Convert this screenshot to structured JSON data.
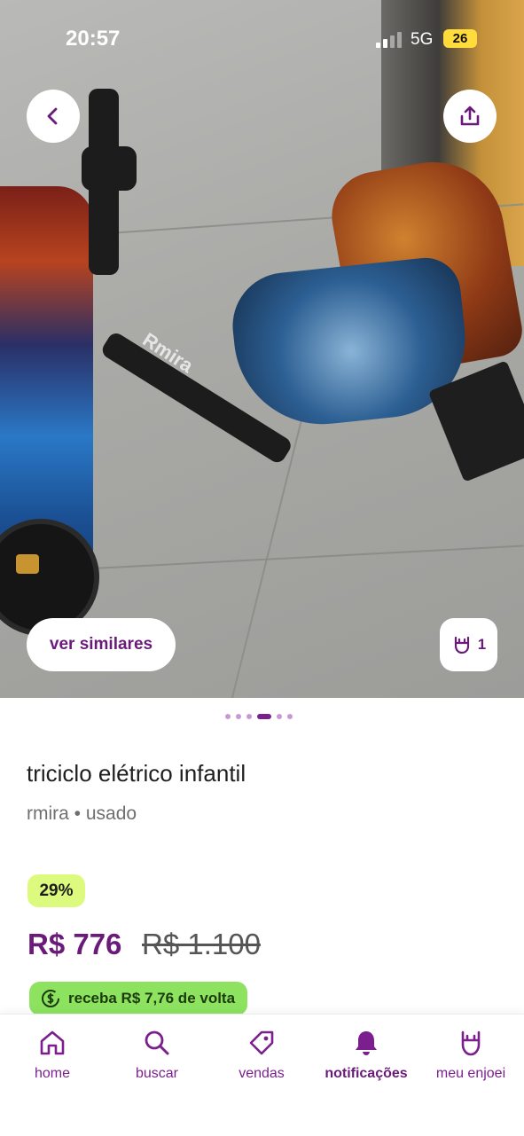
{
  "status_bar": {
    "time": "20:57",
    "network": "5G",
    "battery": "26"
  },
  "product": {
    "title": "triciclo elétrico infantil",
    "brand": "rmira",
    "condition": "usado",
    "discount": "29%",
    "price": "R$ 776",
    "old_price": "R$ 1.100",
    "cashback": "receba R$ 7,76 de volta",
    "likes": "1",
    "image_printed_brand": "Rmira"
  },
  "gallery": {
    "total": 6,
    "active_index": 3
  },
  "buttons": {
    "similar": "ver similares"
  },
  "nav": {
    "items": [
      {
        "label": "home",
        "icon": "home-icon",
        "active": false
      },
      {
        "label": "buscar",
        "icon": "search-icon",
        "active": false
      },
      {
        "label": "vendas",
        "icon": "tag-icon",
        "active": false
      },
      {
        "label": "notificações",
        "icon": "bell-icon",
        "active": true
      },
      {
        "label": "meu enjoei",
        "icon": "rock-hand-icon",
        "active": false
      }
    ]
  },
  "colors": {
    "brand": "#7c1f8e",
    "discount_bg": "#dcfb7e",
    "cashback_bg": "#8de35f"
  }
}
